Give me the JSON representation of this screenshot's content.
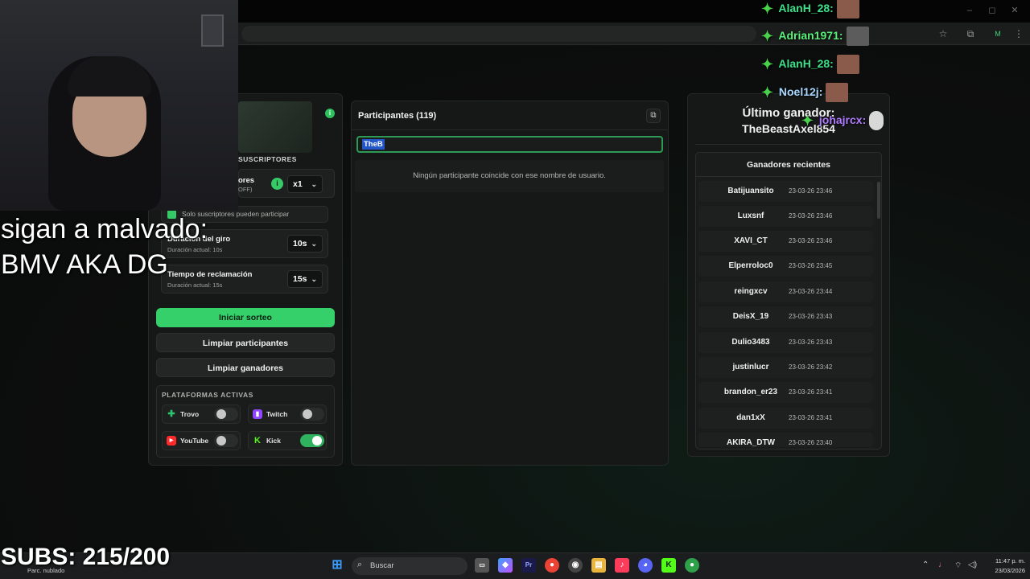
{
  "browser": {
    "window_controls": [
      "–",
      "◻",
      "✕"
    ],
    "profile_badge": "M"
  },
  "left_panel": {
    "subscribers_header": "SUSCRIPTORES",
    "multiplier_title": "ores",
    "multiplier_sub": "OFF)",
    "multiplier_value": "x1",
    "only_subs_label": "Solo suscriptores pueden participar",
    "spin_title": "Duración del giro",
    "spin_sub": "Duración actual: 10s",
    "spin_value": "10s",
    "claim_title": "Tiempo de reclamación",
    "claim_sub": "Duración actual: 15s",
    "claim_value": "15s",
    "start_button": "Iniciar sorteo",
    "clear_participants_button": "Limpiar participantes",
    "clear_winners_button": "Limpiar ganadores",
    "platforms_header": "PLATAFORMAS ACTIVAS",
    "platforms": [
      {
        "name": "Trovo",
        "enabled": false,
        "color": "#2bc36b"
      },
      {
        "name": "Twitch",
        "enabled": false,
        "color": "#9146ff"
      },
      {
        "name": "YouTube",
        "enabled": false,
        "color": "#ff2a2a"
      },
      {
        "name": "Kick",
        "enabled": true,
        "color": "#53fc18"
      }
    ]
  },
  "participants": {
    "title": "Participantes (119)",
    "search_value": "TheB",
    "empty_message": "Ningún participante coincide con ese nombre de usuario."
  },
  "winner_panel": {
    "last_winner_title": "Último ganador:",
    "last_winner_name": "TheBeastAxel854",
    "recent_title": "Ganadores recientes",
    "recent": [
      {
        "name": "Batijuansito",
        "date": "23-03-26 23:46"
      },
      {
        "name": "Luxsnf",
        "date": "23-03-26 23:46"
      },
      {
        "name": "XAVI_CT",
        "date": "23-03-26 23:46"
      },
      {
        "name": "Elperroloc0",
        "date": "23-03-26 23:45"
      },
      {
        "name": "reingxcv",
        "date": "23-03-26 23:44"
      },
      {
        "name": "DeisX_19",
        "date": "23-03-26 23:43"
      },
      {
        "name": "Dulio3483",
        "date": "23-03-26 23:43"
      },
      {
        "name": "justinlucr",
        "date": "23-03-26 23:42"
      },
      {
        "name": "brandon_er23",
        "date": "23-03-26 23:41"
      },
      {
        "name": "dan1xX",
        "date": "23-03-26 23:41"
      },
      {
        "name": "AKIRA_DTW",
        "date": "23-03-26 23:40"
      }
    ]
  },
  "chat": [
    {
      "user": "AlanH_28:",
      "color": "#3fe08a"
    },
    {
      "user": "Adrian1971:",
      "color": "#5af07a"
    },
    {
      "user": "AlanH_28:",
      "color": "#3fe08a"
    },
    {
      "user": "Noel12j:",
      "color": "#a8d8ff"
    },
    {
      "user": "johajrcx:",
      "color": "#b07cff"
    }
  ],
  "overlay": {
    "promo_line1": "sigan a malvado:",
    "promo_line2": "BMV AKA DG",
    "subs": "SUBS: 215/200"
  },
  "taskbar": {
    "search_placeholder": "Buscar",
    "weather": "Parc. nublado",
    "time": "11:47 p. m.",
    "date": "23/03/2026"
  }
}
